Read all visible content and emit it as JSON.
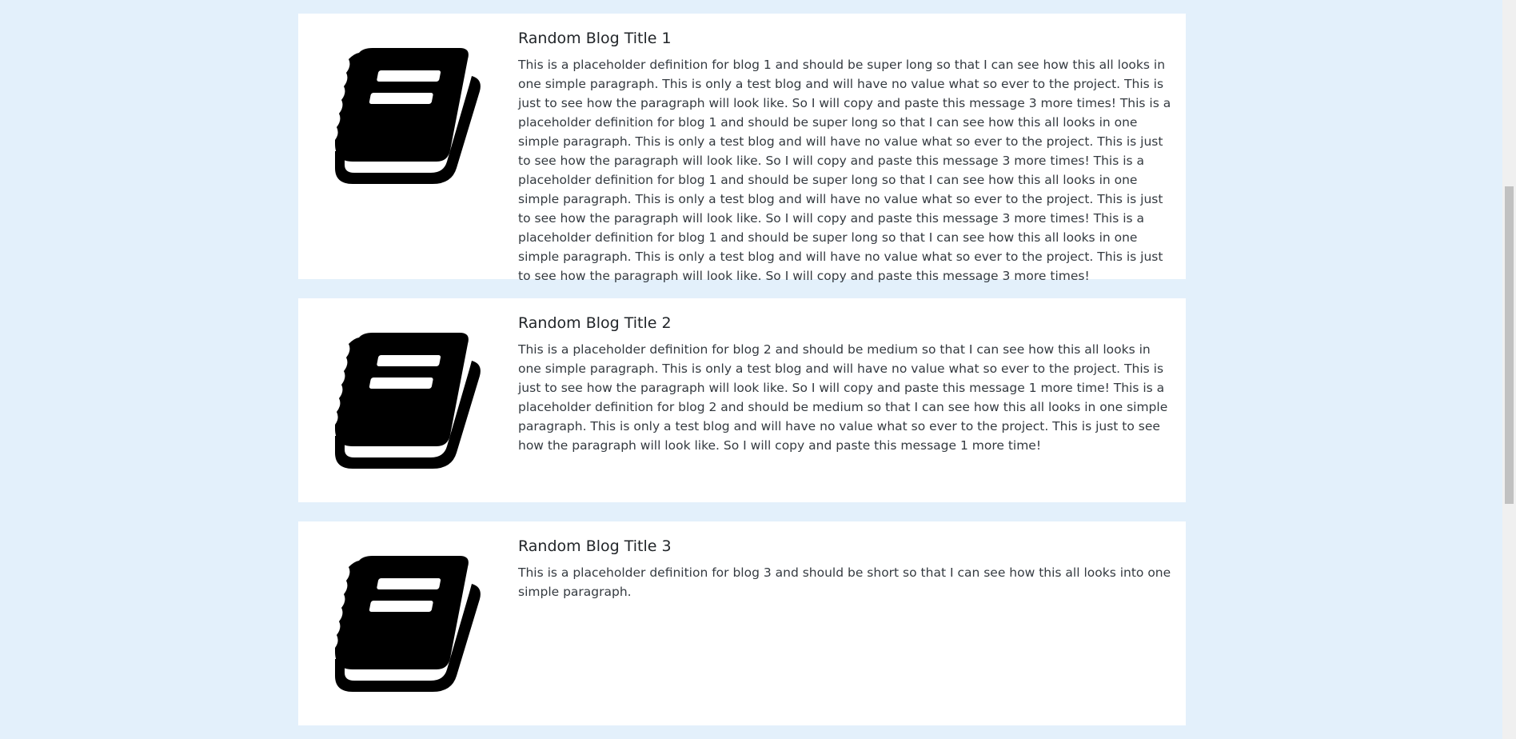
{
  "blogs": [
    {
      "title": "Random Blog Title 1",
      "description": "This is a placeholder definition for blog 1 and should be super long so that I can see how this all looks in one simple paragraph. This is only a test blog and will have no value what so ever to the project. This is just to see how the paragraph will look like. So I will copy and paste this message 3 more times! This is a placeholder definition for blog 1 and should be super long so that I can see how this all looks in one simple paragraph. This is only a test blog and will have no value what so ever to the project. This is just to see how the paragraph will look like. So I will copy and paste this message 3 more times! This is a placeholder definition for blog 1 and should be super long so that I can see how this all looks in one simple paragraph. This is only a test blog and will have no value what so ever to the project. This is just to see how the paragraph will look like. So I will copy and paste this message 3 more times! This is a placeholder definition for blog 1 and should be super long so that I can see how this all looks in one simple paragraph. This is only a test blog and will have no value what so ever to the project. This is just to see how the paragraph will look like. So I will copy and paste this message 3 more times!",
      "icon": "book-icon"
    },
    {
      "title": "Random Blog Title 2",
      "description": "This is a placeholder definition for blog 2 and should be medium so that I can see how this all looks in one simple paragraph. This is only a test blog and will have no value what so ever to the project. This is just to see how the paragraph will look like. So I will copy and paste this message 1 more time! This is a placeholder definition for blog 2 and should be medium so that I can see how this all looks in one simple paragraph. This is only a test blog and will have no value what so ever to the project. This is just to see how the paragraph will look like. So I will copy and paste this message 1 more time!",
      "icon": "book-icon"
    },
    {
      "title": "Random Blog Title 3",
      "description": "This is a placeholder definition for blog 3 and should be short so that I can see how this all looks into one simple paragraph.",
      "icon": "book-icon"
    }
  ],
  "colors": {
    "page_background": "#e3f0fb",
    "card_background": "#ffffff",
    "icon": "#000000"
  }
}
